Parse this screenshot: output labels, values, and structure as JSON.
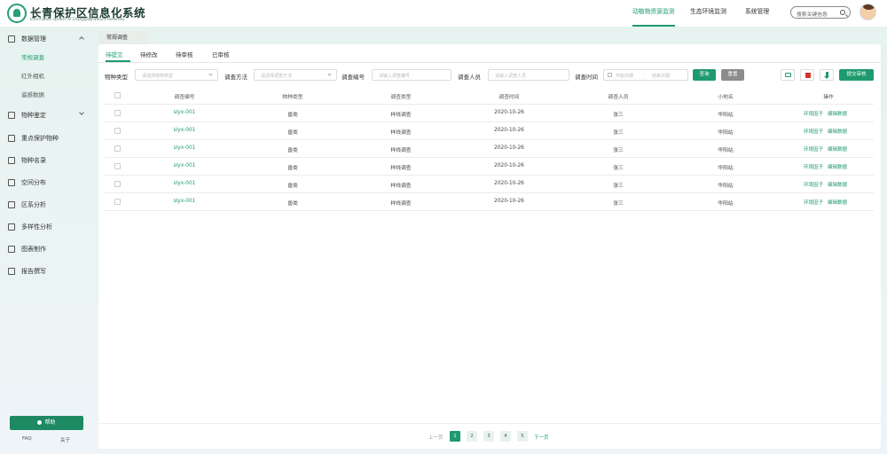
{
  "header": {
    "title": "长青保护区信息化系统",
    "subtitle": "Information system of Changqing Nature Reserves",
    "nav": [
      "动植物资源监测",
      "生态环境监测",
      "系统管理"
    ],
    "search_placeholder": "搜索关键信息"
  },
  "sidebar": {
    "groups": [
      {
        "label": "数据管理",
        "expanded": true,
        "children": [
          "常规调查",
          "红外相机",
          "遥感数据"
        ]
      },
      {
        "label": "物种鉴定",
        "expanded": false
      },
      {
        "label": "重点保护物种"
      },
      {
        "label": "物种名录"
      },
      {
        "label": "空间分布"
      },
      {
        "label": "区系分析"
      },
      {
        "label": "多样性分析"
      },
      {
        "label": "图表制作"
      },
      {
        "label": "报告撰写"
      }
    ],
    "help_label": "帮助",
    "footer_links": [
      "FAQ",
      "关于"
    ]
  },
  "page_tab": "常规调查",
  "tabs": [
    "待提交",
    "待修改",
    "待审核",
    "已审核"
  ],
  "filters": {
    "species_type": {
      "label": "物种类型",
      "placeholder": "请选择物种类型"
    },
    "method": {
      "label": "调查方法",
      "placeholder": "请选择调查方法"
    },
    "code": {
      "label": "调查编号",
      "placeholder": "请输入调查编号"
    },
    "person": {
      "label": "调查人员",
      "placeholder": "请输入调查人员"
    },
    "time": {
      "label": "调查时间",
      "start": "开始日期",
      "sep": "-",
      "end": "结束日期"
    }
  },
  "buttons": {
    "query": "查询",
    "reset": "重置",
    "submit_all": "提交审核"
  },
  "table": {
    "headers": [
      "调查编号",
      "物种类型",
      "调查类型",
      "调查时间",
      "调查人员",
      "小地名",
      "操作"
    ],
    "rows": [
      [
        "slyx-001",
        "兽类",
        "样线调查",
        "2020-10-26",
        "张三",
        "华阳站"
      ],
      [
        "slyx-001",
        "兽类",
        "样线调查",
        "2020-10-26",
        "张三",
        "华阳站"
      ],
      [
        "slyx-001",
        "兽类",
        "样线调查",
        "2020-10-26",
        "张三",
        "华阳站"
      ],
      [
        "slyx-001",
        "兽类",
        "样线调查",
        "2020-10-26",
        "张三",
        "华阳站"
      ],
      [
        "slyx-001",
        "兽类",
        "样线调查",
        "2020-10-26",
        "张三",
        "华阳站"
      ],
      [
        "slyx-001",
        "兽类",
        "样线调查",
        "2020-10-26",
        "张三",
        "华阳站"
      ]
    ],
    "actions": [
      "环境因子",
      "编辑数据"
    ]
  },
  "pagination": {
    "prev": "上一页",
    "pages": [
      "1",
      "2",
      "3",
      "4",
      "5"
    ],
    "current": "1",
    "next": "下一页"
  },
  "colors": {
    "accent": "#1e9a6e",
    "danger": "#d9342b",
    "reset": "#8c8c8c"
  }
}
